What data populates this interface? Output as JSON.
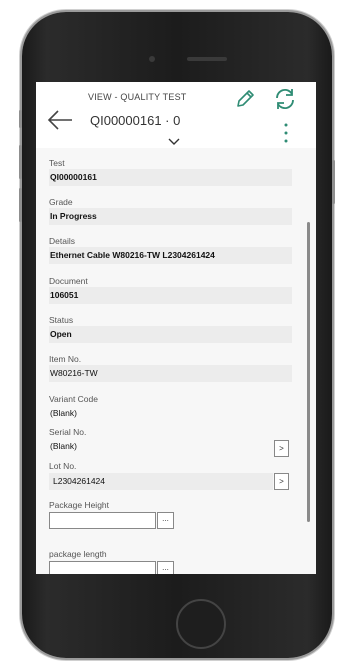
{
  "header": {
    "subtitle": "VIEW - QUALITY TEST",
    "title": "QI00000161 · 0"
  },
  "fields": {
    "test": {
      "label": "Test",
      "value": "QI00000161"
    },
    "grade": {
      "label": "Grade",
      "value": "In Progress"
    },
    "details": {
      "label": "Details",
      "value": "Ethernet Cable W80216-TW L2304261424"
    },
    "document": {
      "label": "Document",
      "value": "106051"
    },
    "status": {
      "label": "Status",
      "value": "Open"
    },
    "item_no": {
      "label": "Item No.",
      "value": "W80216-TW"
    },
    "variant_code": {
      "label": "Variant Code",
      "value": "(Blank)"
    },
    "serial_no": {
      "label": "Serial No.",
      "value": "(Blank)",
      "button": ">"
    },
    "lot_no": {
      "label": "Lot No.",
      "value": "L2304261424",
      "button": ">"
    },
    "package_height": {
      "label": "Package Height",
      "value": "",
      "button": "..."
    },
    "package_length": {
      "label": "package length",
      "value": "",
      "button": "..."
    }
  },
  "icons": {
    "back": "back-arrow-icon",
    "edit": "pencil-icon",
    "refresh": "refresh-icon",
    "more": "more-vertical-icon",
    "collapse": "chevron-down-icon"
  },
  "colors": {
    "accent": "#2f8c74",
    "header_text": "#333333",
    "field_bg": "#ececec"
  }
}
